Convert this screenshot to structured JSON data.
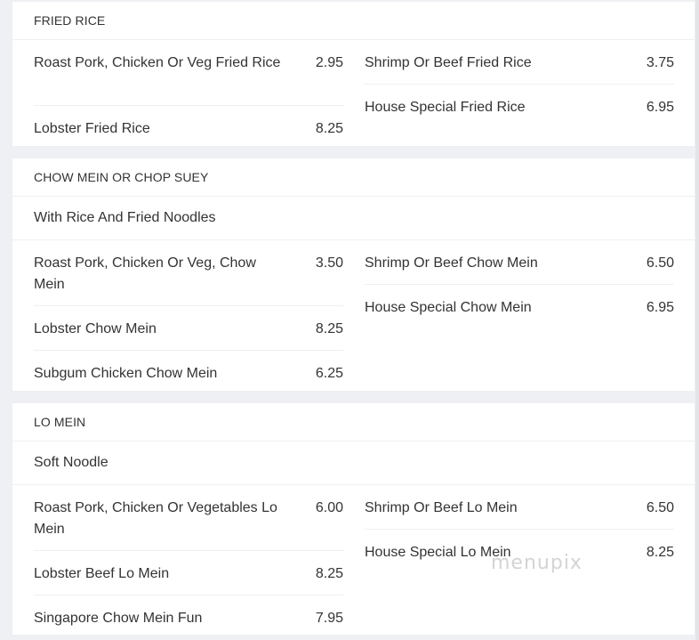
{
  "sections": [
    {
      "title": "FRIED RICE",
      "left": [
        {
          "name": "Roast Pork, Chicken Or Veg Fried Rice",
          "price": "2.95"
        },
        {
          "name": "Lobster Fried Rice",
          "price": "8.25"
        }
      ],
      "right": [
        {
          "name": "Shrimp Or Beef Fried Rice",
          "price": "3.75"
        },
        {
          "name": "House Special Fried Rice",
          "price": "6.95"
        }
      ]
    },
    {
      "title": "CHOW MEIN OR CHOP SUEY",
      "description": "With Rice And Fried Noodles",
      "left": [
        {
          "name": "Roast Pork, Chicken Or Veg, Chow Mein",
          "price": "3.50"
        },
        {
          "name": "Lobster Chow Mein",
          "price": "8.25"
        },
        {
          "name": "Subgum Chicken Chow Mein",
          "price": "6.25"
        }
      ],
      "right": [
        {
          "name": "Shrimp Or Beef Chow Mein",
          "price": "6.50"
        },
        {
          "name": "House Special Chow Mein",
          "price": "6.95"
        }
      ]
    },
    {
      "title": "LO MEIN",
      "description": "Soft Noodle",
      "left": [
        {
          "name": "Roast Pork, Chicken Or Vegetables Lo Mein",
          "price": "6.00"
        },
        {
          "name": "Lobster Beef Lo Mein",
          "price": "8.25"
        },
        {
          "name": "Singapore Chow Mein Fun",
          "price": "7.95"
        }
      ],
      "right": [
        {
          "name": "Shrimp Or Beef Lo Mein",
          "price": "6.50"
        },
        {
          "name": "House Special Lo Mein",
          "price": "8.25"
        }
      ]
    }
  ],
  "watermark": "menupix"
}
